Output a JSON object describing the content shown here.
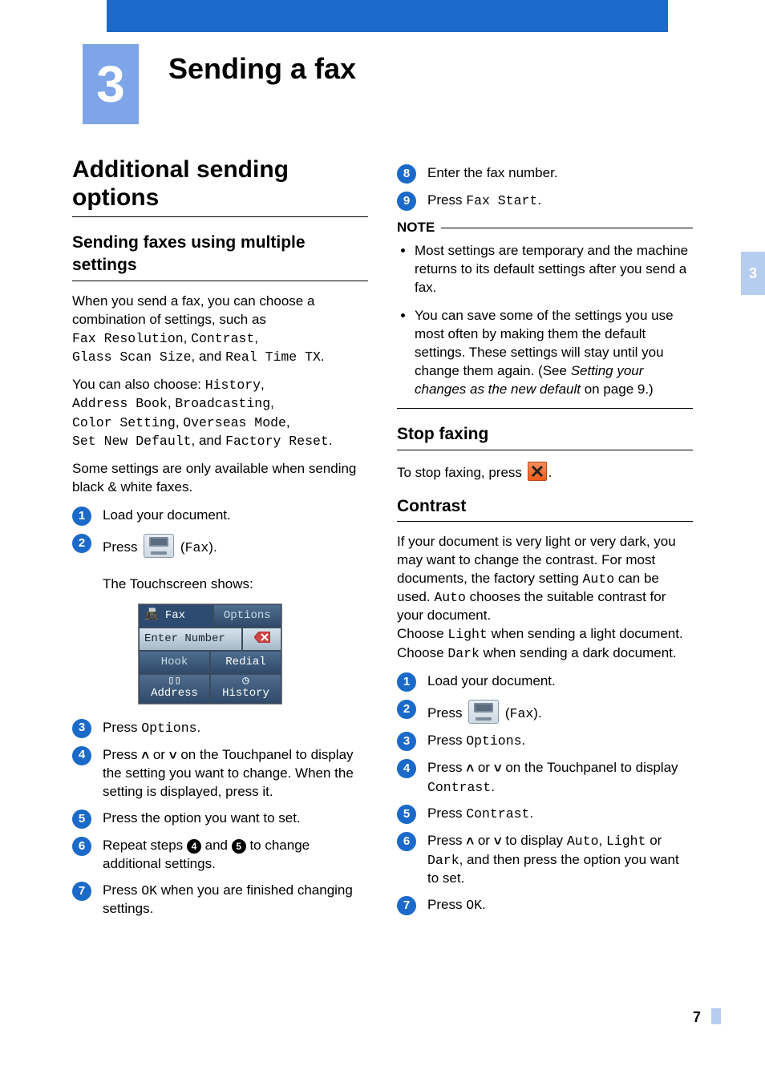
{
  "chapter": {
    "number": "3",
    "title": "Sending a fax"
  },
  "sidetab": "3",
  "pagenum": "7",
  "left": {
    "h1": "Additional sending options",
    "h2_1": "Sending faxes using multiple settings",
    "p1_a": "When you send a fax, you can choose a combination of settings, such as",
    "p1_opts": {
      "a": "Fax Resolution",
      "b": "Contrast",
      "c": "Glass Scan Size",
      "d": "Real Time TX"
    },
    "p1_b": ", and ",
    "p2_a": "You can also choose: ",
    "p2_opts": {
      "a": "History",
      "b": "Address Book",
      "c": "Broadcasting",
      "d": "Color Setting",
      "e": "Overseas Mode",
      "f": "Set New Default",
      "g": "Factory Reset"
    },
    "p2_and": ", and ",
    "p3": "Some settings are only available when sending black & white faxes.",
    "steps": {
      "s1": "Load your document.",
      "s2_a": "Press ",
      "s2_b": " (",
      "s2_c": "Fax",
      "s2_d": ").",
      "s2_sub": "The Touchscreen shows:",
      "s3_a": "Press ",
      "s3_b": "Options",
      "s3_c": ".",
      "s4_a": "Press ",
      "s4_b": " or ",
      "s4_c": " on the Touchpanel to display the setting you want to change. When the setting is displayed, press it.",
      "s5": "Press the option you want to set.",
      "s6_a": "Repeat steps ",
      "s6_b": " and ",
      "s6_c": " to change additional settings.",
      "s6_ref1": "4",
      "s6_ref2": "5",
      "s7_a": "Press ",
      "s7_b": "OK",
      "s7_c": " when you are finished changing settings."
    },
    "touchscreen": {
      "title": "Fax",
      "options": "Options",
      "enter": "Enter Number",
      "hook": "Hook",
      "redial": "Redial",
      "address": "Address",
      "history": "History"
    }
  },
  "right": {
    "s8": "Enter the fax number.",
    "s9_a": "Press ",
    "s9_b": "Fax Start",
    "s9_c": ".",
    "note": {
      "title": "NOTE",
      "i1": "Most settings are temporary and the machine returns to its default settings after you send a fax.",
      "i2_a": "You can save some of the settings you use most often by making them the default settings. These settings will stay until you change them again. (See ",
      "i2_xref": "Setting your changes as the new default",
      "i2_b": " on page 9.)"
    },
    "h2_stop": "Stop faxing",
    "stop_a": "To stop faxing, press ",
    "stop_b": ".",
    "h2_contrast": "Contrast",
    "c_p1_a": "If your document is very light or very dark, you may want to change the contrast. For most documents, the factory setting ",
    "c_p1_b": "Auto",
    "c_p1_c": " can be used. ",
    "c_p1_d": "Auto",
    "c_p1_e": " chooses the suitable contrast for your document.",
    "c_p2_a": "Choose ",
    "c_p2_b": "Light",
    "c_p2_c": " when sending a light document. Choose ",
    "c_p2_d": "Dark",
    "c_p2_e": " when sending a dark document.",
    "csteps": {
      "s1": "Load your document.",
      "s2_a": "Press ",
      "s2_b": " (",
      "s2_c": "Fax",
      "s2_d": ").",
      "s3_a": "Press ",
      "s3_b": "Options",
      "s3_c": ".",
      "s4_a": "Press ",
      "s4_b": " or ",
      "s4_c": " on the Touchpanel to display ",
      "s4_d": "Contrast",
      "s4_e": ".",
      "s5_a": "Press ",
      "s5_b": "Contrast",
      "s5_c": ".",
      "s6_a": "Press ",
      "s6_b": " or ",
      "s6_c": " to display ",
      "s6_d": "Auto",
      "s6_e": ", ",
      "s6_f": "Light",
      "s6_g": " or ",
      "s6_h": "Dark",
      "s6_i": ", and then press the option you want to set.",
      "s7_a": "Press ",
      "s7_b": "OK",
      "s7_c": "."
    }
  }
}
